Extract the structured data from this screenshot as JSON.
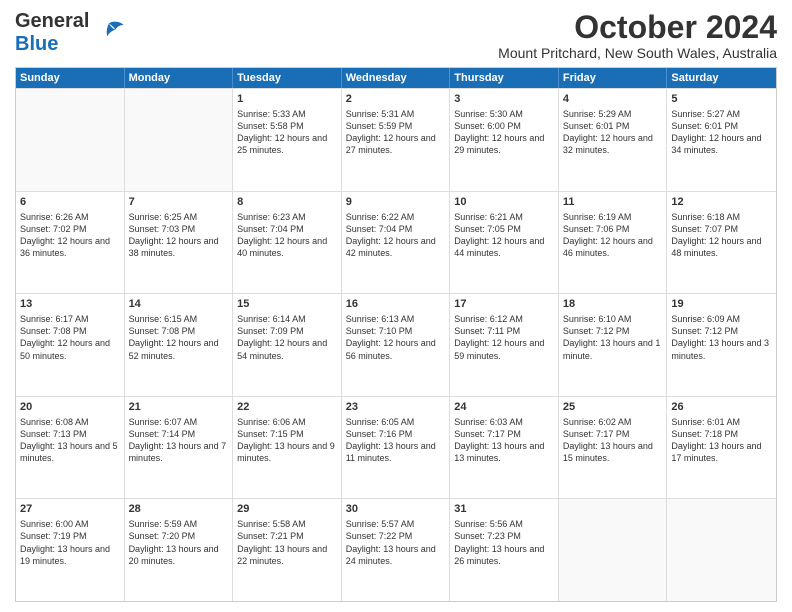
{
  "header": {
    "logo_general": "General",
    "logo_blue": "Blue",
    "month": "October 2024",
    "location": "Mount Pritchard, New South Wales, Australia"
  },
  "calendar": {
    "days": [
      "Sunday",
      "Monday",
      "Tuesday",
      "Wednesday",
      "Thursday",
      "Friday",
      "Saturday"
    ],
    "rows": [
      [
        {
          "day": "",
          "sunrise": "",
          "sunset": "",
          "daylight": ""
        },
        {
          "day": "",
          "sunrise": "",
          "sunset": "",
          "daylight": ""
        },
        {
          "day": "1",
          "sunrise": "Sunrise: 5:33 AM",
          "sunset": "Sunset: 5:58 PM",
          "daylight": "Daylight: 12 hours and 25 minutes."
        },
        {
          "day": "2",
          "sunrise": "Sunrise: 5:31 AM",
          "sunset": "Sunset: 5:59 PM",
          "daylight": "Daylight: 12 hours and 27 minutes."
        },
        {
          "day": "3",
          "sunrise": "Sunrise: 5:30 AM",
          "sunset": "Sunset: 6:00 PM",
          "daylight": "Daylight: 12 hours and 29 minutes."
        },
        {
          "day": "4",
          "sunrise": "Sunrise: 5:29 AM",
          "sunset": "Sunset: 6:01 PM",
          "daylight": "Daylight: 12 hours and 32 minutes."
        },
        {
          "day": "5",
          "sunrise": "Sunrise: 5:27 AM",
          "sunset": "Sunset: 6:01 PM",
          "daylight": "Daylight: 12 hours and 34 minutes."
        }
      ],
      [
        {
          "day": "6",
          "sunrise": "Sunrise: 6:26 AM",
          "sunset": "Sunset: 7:02 PM",
          "daylight": "Daylight: 12 hours and 36 minutes."
        },
        {
          "day": "7",
          "sunrise": "Sunrise: 6:25 AM",
          "sunset": "Sunset: 7:03 PM",
          "daylight": "Daylight: 12 hours and 38 minutes."
        },
        {
          "day": "8",
          "sunrise": "Sunrise: 6:23 AM",
          "sunset": "Sunset: 7:04 PM",
          "daylight": "Daylight: 12 hours and 40 minutes."
        },
        {
          "day": "9",
          "sunrise": "Sunrise: 6:22 AM",
          "sunset": "Sunset: 7:04 PM",
          "daylight": "Daylight: 12 hours and 42 minutes."
        },
        {
          "day": "10",
          "sunrise": "Sunrise: 6:21 AM",
          "sunset": "Sunset: 7:05 PM",
          "daylight": "Daylight: 12 hours and 44 minutes."
        },
        {
          "day": "11",
          "sunrise": "Sunrise: 6:19 AM",
          "sunset": "Sunset: 7:06 PM",
          "daylight": "Daylight: 12 hours and 46 minutes."
        },
        {
          "day": "12",
          "sunrise": "Sunrise: 6:18 AM",
          "sunset": "Sunset: 7:07 PM",
          "daylight": "Daylight: 12 hours and 48 minutes."
        }
      ],
      [
        {
          "day": "13",
          "sunrise": "Sunrise: 6:17 AM",
          "sunset": "Sunset: 7:08 PM",
          "daylight": "Daylight: 12 hours and 50 minutes."
        },
        {
          "day": "14",
          "sunrise": "Sunrise: 6:15 AM",
          "sunset": "Sunset: 7:08 PM",
          "daylight": "Daylight: 12 hours and 52 minutes."
        },
        {
          "day": "15",
          "sunrise": "Sunrise: 6:14 AM",
          "sunset": "Sunset: 7:09 PM",
          "daylight": "Daylight: 12 hours and 54 minutes."
        },
        {
          "day": "16",
          "sunrise": "Sunrise: 6:13 AM",
          "sunset": "Sunset: 7:10 PM",
          "daylight": "Daylight: 12 hours and 56 minutes."
        },
        {
          "day": "17",
          "sunrise": "Sunrise: 6:12 AM",
          "sunset": "Sunset: 7:11 PM",
          "daylight": "Daylight: 12 hours and 59 minutes."
        },
        {
          "day": "18",
          "sunrise": "Sunrise: 6:10 AM",
          "sunset": "Sunset: 7:12 PM",
          "daylight": "Daylight: 13 hours and 1 minute."
        },
        {
          "day": "19",
          "sunrise": "Sunrise: 6:09 AM",
          "sunset": "Sunset: 7:12 PM",
          "daylight": "Daylight: 13 hours and 3 minutes."
        }
      ],
      [
        {
          "day": "20",
          "sunrise": "Sunrise: 6:08 AM",
          "sunset": "Sunset: 7:13 PM",
          "daylight": "Daylight: 13 hours and 5 minutes."
        },
        {
          "day": "21",
          "sunrise": "Sunrise: 6:07 AM",
          "sunset": "Sunset: 7:14 PM",
          "daylight": "Daylight: 13 hours and 7 minutes."
        },
        {
          "day": "22",
          "sunrise": "Sunrise: 6:06 AM",
          "sunset": "Sunset: 7:15 PM",
          "daylight": "Daylight: 13 hours and 9 minutes."
        },
        {
          "day": "23",
          "sunrise": "Sunrise: 6:05 AM",
          "sunset": "Sunset: 7:16 PM",
          "daylight": "Daylight: 13 hours and 11 minutes."
        },
        {
          "day": "24",
          "sunrise": "Sunrise: 6:03 AM",
          "sunset": "Sunset: 7:17 PM",
          "daylight": "Daylight: 13 hours and 13 minutes."
        },
        {
          "day": "25",
          "sunrise": "Sunrise: 6:02 AM",
          "sunset": "Sunset: 7:17 PM",
          "daylight": "Daylight: 13 hours and 15 minutes."
        },
        {
          "day": "26",
          "sunrise": "Sunrise: 6:01 AM",
          "sunset": "Sunset: 7:18 PM",
          "daylight": "Daylight: 13 hours and 17 minutes."
        }
      ],
      [
        {
          "day": "27",
          "sunrise": "Sunrise: 6:00 AM",
          "sunset": "Sunset: 7:19 PM",
          "daylight": "Daylight: 13 hours and 19 minutes."
        },
        {
          "day": "28",
          "sunrise": "Sunrise: 5:59 AM",
          "sunset": "Sunset: 7:20 PM",
          "daylight": "Daylight: 13 hours and 20 minutes."
        },
        {
          "day": "29",
          "sunrise": "Sunrise: 5:58 AM",
          "sunset": "Sunset: 7:21 PM",
          "daylight": "Daylight: 13 hours and 22 minutes."
        },
        {
          "day": "30",
          "sunrise": "Sunrise: 5:57 AM",
          "sunset": "Sunset: 7:22 PM",
          "daylight": "Daylight: 13 hours and 24 minutes."
        },
        {
          "day": "31",
          "sunrise": "Sunrise: 5:56 AM",
          "sunset": "Sunset: 7:23 PM",
          "daylight": "Daylight: 13 hours and 26 minutes."
        },
        {
          "day": "",
          "sunrise": "",
          "sunset": "",
          "daylight": ""
        },
        {
          "day": "",
          "sunrise": "",
          "sunset": "",
          "daylight": ""
        }
      ]
    ]
  }
}
